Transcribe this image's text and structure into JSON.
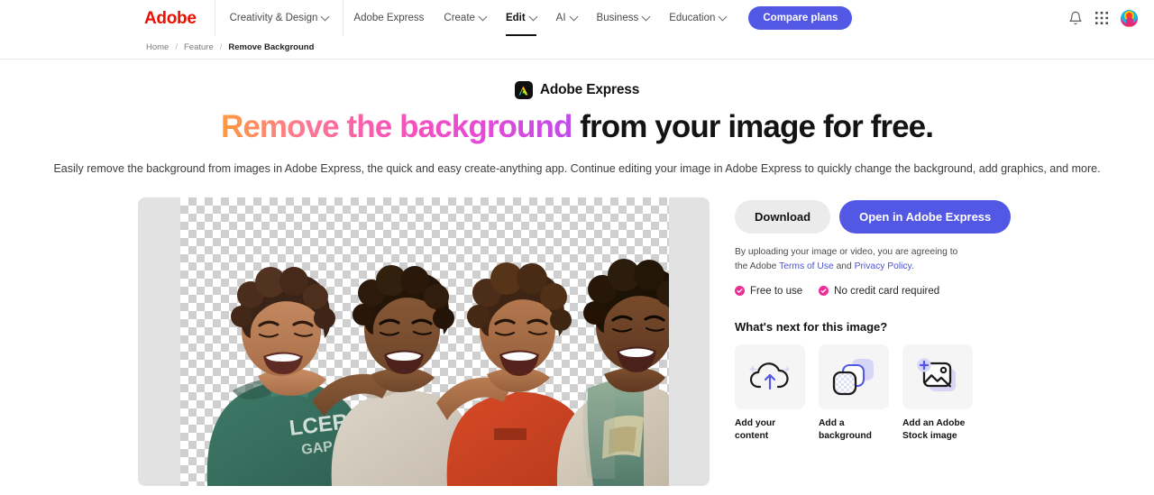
{
  "gnav": {
    "brand": "Adobe",
    "items": [
      {
        "label": "Creativity & Design",
        "caret": true,
        "active": false
      },
      {
        "label": "Adobe Express",
        "caret": false,
        "active": false
      },
      {
        "label": "Create",
        "caret": true,
        "active": false
      },
      {
        "label": "Edit",
        "caret": true,
        "active": true
      },
      {
        "label": "AI",
        "caret": true,
        "active": false
      },
      {
        "label": "Business",
        "caret": true,
        "active": false
      },
      {
        "label": "Education",
        "caret": true,
        "active": false
      }
    ],
    "compare_label": "Compare plans",
    "icons": {
      "notifications": "bell-icon",
      "app_switcher": "app-grid-icon",
      "account": "avatar"
    }
  },
  "breadcrumb": {
    "items": [
      "Home",
      "Feature",
      "Remove Background"
    ],
    "separator": "/"
  },
  "hero": {
    "badge_label": "Adobe Express",
    "title_gradient": "Remove the background",
    "title_rest": "from your image for free.",
    "subtitle": "Easily remove the background from images in Adobe Express, the quick and easy create-anything app. Continue editing your image in Adobe Express to quickly change the background, add graphics, and more."
  },
  "canvas": {
    "name": "image-preview-canvas",
    "transparency": "checkerboard",
    "subject": "Four smiling children with arms around each other, background removed"
  },
  "panel": {
    "download_label": "Download",
    "open_label": "Open in Adobe Express",
    "legal_prefix": "By uploading your image or video, you are agreeing to the Adobe ",
    "legal_terms": "Terms of Use",
    "legal_and": " and ",
    "legal_privacy": "Privacy Policy",
    "legal_suffix": ".",
    "perks": [
      "Free to use",
      "No credit card required"
    ],
    "next_title": "What's next for this image?",
    "cards": [
      {
        "label": "Add your content",
        "icon": "cloud-upload-icon"
      },
      {
        "label": "Add a background",
        "icon": "layers-background-icon"
      },
      {
        "label": "Add an Adobe Stock image",
        "icon": "add-image-icon"
      }
    ]
  },
  "colors": {
    "adobe_red": "#EB1000",
    "brand_purple": "#5258e4",
    "accent_pink": "#ed2e96",
    "link_blue": "#4a53d8",
    "canvas_gray": "#e2e2e2"
  }
}
